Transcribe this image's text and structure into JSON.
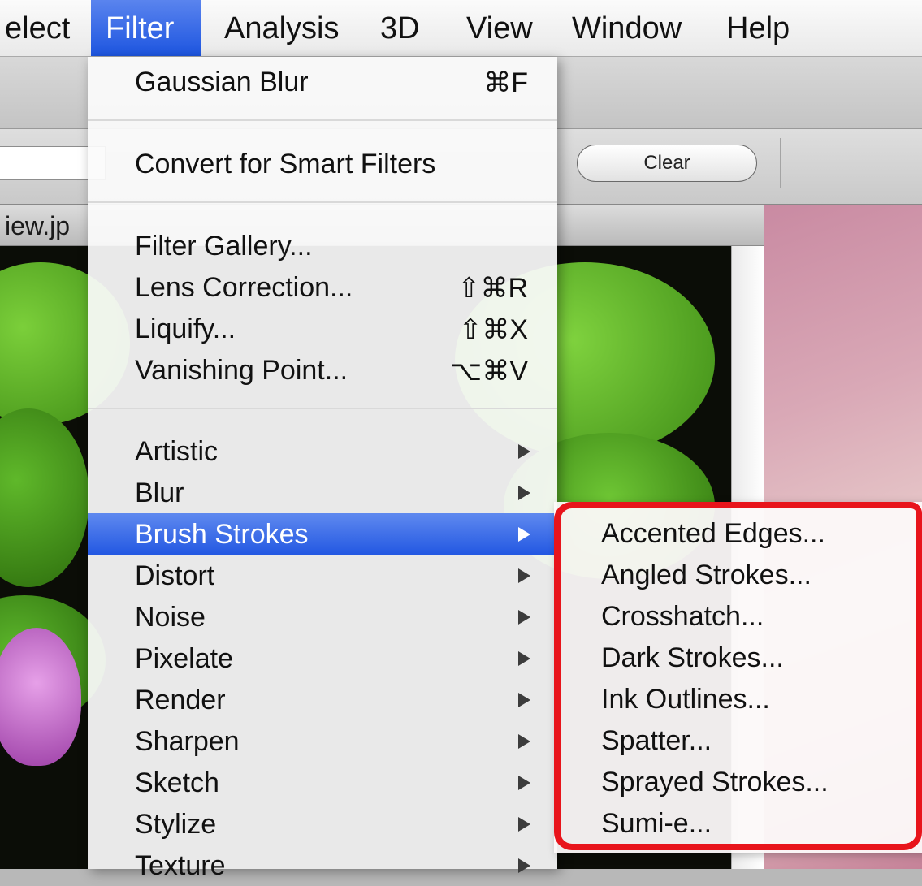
{
  "menubar": {
    "items": [
      {
        "label": "elect",
        "active": false
      },
      {
        "label": "Filter",
        "active": true
      },
      {
        "label": "Analysis",
        "active": false
      },
      {
        "label": "3D",
        "active": false
      },
      {
        "label": "View",
        "active": false
      },
      {
        "label": "Window",
        "active": false
      },
      {
        "label": "Help",
        "active": false
      }
    ]
  },
  "options_bar": {
    "clear_button": "Clear"
  },
  "document": {
    "title": "iew.jp"
  },
  "filter_menu": {
    "items": [
      {
        "label": "Gaussian Blur",
        "shortcut": "⌘F"
      },
      {
        "label": "Convert for Smart Filters",
        "shortcut": ""
      },
      {
        "label": "Filter Gallery...",
        "shortcut": ""
      },
      {
        "label": "Lens Correction...",
        "shortcut": "⇧⌘R"
      },
      {
        "label": "Liquify...",
        "shortcut": "⇧⌘X"
      },
      {
        "label": "Vanishing Point...",
        "shortcut": "⌥⌘V"
      },
      {
        "label": "Artistic",
        "shortcut": ""
      },
      {
        "label": "Blur",
        "shortcut": ""
      },
      {
        "label": "Brush Strokes",
        "shortcut": ""
      },
      {
        "label": "Distort",
        "shortcut": ""
      },
      {
        "label": "Noise",
        "shortcut": ""
      },
      {
        "label": "Pixelate",
        "shortcut": ""
      },
      {
        "label": "Render",
        "shortcut": ""
      },
      {
        "label": "Sharpen",
        "shortcut": ""
      },
      {
        "label": "Sketch",
        "shortcut": ""
      },
      {
        "label": "Stylize",
        "shortcut": ""
      },
      {
        "label": "Texture",
        "shortcut": ""
      }
    ],
    "highlighted": "Brush Strokes"
  },
  "brush_strokes_submenu": {
    "items": [
      "Accented Edges...",
      "Angled Strokes...",
      "Crosshatch...",
      "Dark Strokes...",
      "Ink Outlines...",
      "Spatter...",
      "Sprayed Strokes...",
      "Sumi-e..."
    ],
    "highlight_color": "#e8141b"
  },
  "colors": {
    "menu_highlight": "#2358e2",
    "callout_border": "#e8141b"
  }
}
